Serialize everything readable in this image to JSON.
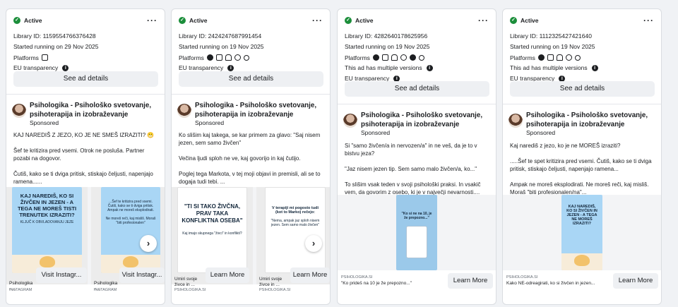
{
  "status_label": "Active",
  "see_details_label": "See ad details",
  "platforms_label": "Platforms",
  "eu_label": "EU transparency",
  "versions_label": "This ad has multiple versions",
  "more_label": "···",
  "cards": [
    {
      "library_id": "Library ID: 1159554766376428",
      "started": "Started running on 29 Nov 2025",
      "platforms": [
        "instagram-icon"
      ],
      "advertiser_line1": "Psihologika - Psihološko svetovanje,",
      "advertiser_line2": "psihoterapija in izobraževanje",
      "sponsored": "Sponsored",
      "body": "KAJ NAREDIŠ Z JEZO, KO JE NE SMEŠ IZRAZITI? 😬\n\nŠef te kritizira pred vsemi. Otrok ne posluša. Partner pozabi na dogovor.\n\nČutiš, kako se ti dviga pritisk, stiskajo čeljusti, napenjajo ramena......",
      "creatives": [
        {
          "headline": "KAJ NAREDIŠ, KO SI ŽIVČEN IN JEZEN - A TEGA NE MOREŠ TISTI TRENUTEK IZRAZITI?",
          "small": "KLJUČ K OBVLADOVANJU JEZE",
          "source": "INSTAGRAM",
          "title": "Psihologika - ...",
          "cta": "Visit Instagr..."
        },
        {
          "headline": "...Šef te kritizira pred vsemi. Čutiš, kako se ti dviga pritisk. Ampak ne moreš eksplodirati.",
          "small": "Ne moreš reči, kaj misliš. Moraš \"biti profesionalen\"",
          "source": "INSTAGRAM",
          "title": "Psihologika - ...",
          "cta": "Visit Instagr..."
        }
      ]
    },
    {
      "library_id": "Library ID: 2424247687991454",
      "started": "Started running on 19 Nov 2025",
      "platforms": [
        "facebook-icon",
        "instagram-icon",
        "audience-network-icon",
        "messenger-icon",
        "threads-icon"
      ],
      "advertiser_line1": "Psihologika - Psihološko svetovanje,",
      "advertiser_line2": "psihoterapija in izobraževanje",
      "sponsored": "Sponsored",
      "body": "Ko slišim kaj takega, se kar primem za glavo: \"Saj nisem jezen, sem samo živčen\"\n\nVečina ljudi sploh ne ve, kaj govorijo in kaj čutijo.\n\nPoglej tega Markota, v tej moji objavi in premisli, ali se to dogaja tudi tebi. ...",
      "creatives": [
        {
          "headline": "\"TI SI TAKO ŽIVČNA, PRAV TAKA KONFLIKTNA OSEBA\"",
          "small": "Kaj imajo skupnega \"živci\" in konflikti?",
          "source": "PSIHOLOGIKA.SI",
          "title": "Umiri svoje živce in ...",
          "cta": "Learn More"
        },
        {
          "headline": "V terapiji mi pogosto tudi (kot to Marko) rečejo:",
          "small": "\"Nema, ampak jaz sploh nisem jezen. Sem samo malo živčen\"",
          "source": "PSIHOLOGIKA.SI",
          "title": "Umiri svoje živce in ...",
          "cta": "Learn More"
        }
      ]
    },
    {
      "library_id": "Library ID: 4282640178625956",
      "started": "Started running on 19 Nov 2025",
      "platforms": [
        "facebook-icon",
        "instagram-icon",
        "audience-network-icon",
        "messenger-icon",
        "threads-icon",
        "whatsapp-icon"
      ],
      "versions": true,
      "advertiser_line1": "Psihologika - Psihološko svetovanje,",
      "advertiser_line2": "psihoterapija in izobraževanje",
      "sponsored": "Sponsored",
      "body": "Si \"samo živčen/a in nervozen/a\" in ne veš, da je to v bistvu jeza?\n\n\"Jaz nisem jezen tip. Sem samo malo živčen/a, ko...\"\n\nTo slišim vsak teden v svoji psihološki praksi. In vsakič vem, da govorim z osebo, ki je v največji nevarnosti....",
      "creatives": [
        {
          "headline": "\"Ko si ne na 10, je že prepozno...\"",
          "small": "",
          "source": "PSIHOLOGIKA.SI",
          "title": "\"Ko prideš na 10 je že prepozno...\"",
          "cta": "Learn More"
        }
      ]
    },
    {
      "library_id": "Library ID: 1112325427421640",
      "started": "Started running on 19 Nov 2025",
      "platforms": [
        "facebook-icon",
        "instagram-icon",
        "audience-network-icon",
        "messenger-icon",
        "threads-icon"
      ],
      "versions": true,
      "advertiser_line1": "Psihologika - Psihološko svetovanje,",
      "advertiser_line2": "psihoterapija in izobraževanje",
      "sponsored": "Sponsored",
      "body": "Kaj narediš z jezo, ko je ne MOREŠ izraziti?\n\n.....Šef te spet kritizira pred vsemi. Čutiš, kako se ti dviga pritisk, stiskajo čeljusti, napenjajo ramena...\n\nAmpak ne moreš eksplodirati. Ne moreš reči, kaj misliš. Moraš \"biti profesionalen/na\"...",
      "creatives": [
        {
          "headline": "KAJ NAREDIŠ, KO SI ŽIVČEN IN JEZEN - A TEGA NE MOREŠ IZRAZITI?",
          "small": "",
          "source": "PSIHOLOGIKA.SI",
          "title": "Kako NE-odreagirati, ko si živčen in jezen...",
          "cta": "Learn More"
        }
      ]
    }
  ]
}
